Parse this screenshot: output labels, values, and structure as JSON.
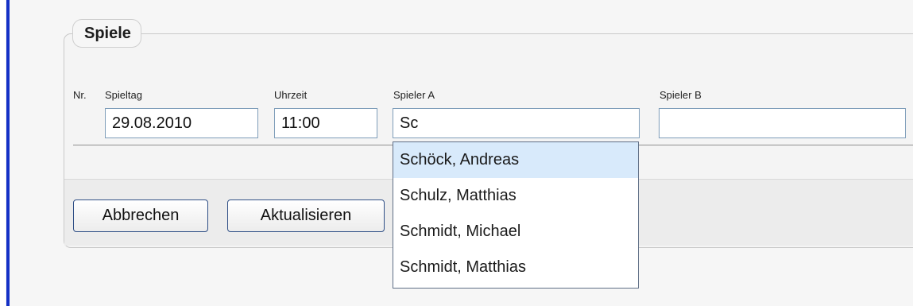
{
  "fieldset": {
    "legend": "Spiele"
  },
  "table": {
    "headers": {
      "nr": "Nr.",
      "spieltag": "Spieltag",
      "uhrzeit": "Uhrzeit",
      "spieler_a": "Spieler A",
      "spieler_b": "Spieler B"
    },
    "row": {
      "spieltag": "29.08.2010",
      "uhrzeit": "11:00",
      "spieler_a": "Sc",
      "spieler_b": ""
    }
  },
  "autocomplete": {
    "options": [
      "Schöck, Andreas",
      "Schulz, Matthias",
      "Schmidt, Michael",
      "Schmidt, Matthias"
    ],
    "highlighted_index": 0
  },
  "buttons": {
    "cancel": "Abbrechen",
    "update": "Aktualisieren"
  },
  "colors": {
    "accent_bar": "#1430c6",
    "input_border": "#7e9db9",
    "highlight": "#d8eafb"
  }
}
